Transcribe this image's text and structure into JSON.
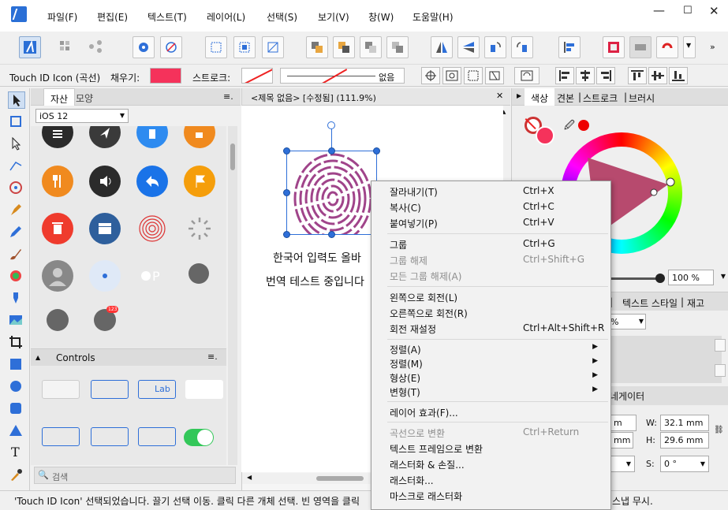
{
  "menubar": {
    "items": [
      "파일(F)",
      "편집(E)",
      "텍스트(T)",
      "레이어(L)",
      "선택(S)",
      "보기(V)",
      "창(W)",
      "도움말(H)"
    ]
  },
  "context": {
    "selection_name": "Touch ID Icon (곡선)",
    "fill_label": "채우기:",
    "stroke_label": "스트로크:",
    "stroke_value": "없음",
    "fill_color": "#f5325b"
  },
  "assets": {
    "tab_assets": "자산",
    "tab_shapes": "모양",
    "category": "iOS 12",
    "section": "Controls",
    "control_label": "Lab",
    "badge": "123",
    "search_placeholder": "검색",
    "left_arrow": "◀"
  },
  "document": {
    "tab_title": "<제목 없음> [수정됨] (111.9%)",
    "close": "✕",
    "text_line1": "한국어 입력도 올바",
    "text_line2": "번역 테스트 중입니다"
  },
  "right_panel": {
    "tab_color": "색상",
    "tab_swatches": "견본",
    "tab_stroke": "스트로크",
    "tab_brush": "브러시",
    "opacity": "100 %",
    "tab_text_style": "텍스트 스타일",
    "tab_stock": "재고",
    "percent_fragment": "%",
    "navigator_fragment": "네게이터",
    "w_label": "W:",
    "w_value": "32.1 mm",
    "h_label": "H:",
    "h_value": "29.6 mm",
    "s_label": "S:",
    "s_value": "0 °",
    "mm1": "m",
    "mm2": "mm",
    "seg_fragment": "일",
    "separator": "|"
  },
  "statusbar": {
    "text": "'Touch ID Icon' 선택되었습니다. 끌기 선택 이동. 클릭 다른 개체 선택. 빈 영역을 클릭",
    "text_right": "스냅 무시."
  },
  "context_menu": {
    "items": [
      {
        "label": "잘라내기(T)",
        "shortcut": "Ctrl+X"
      },
      {
        "label": "복사(C)",
        "shortcut": "Ctrl+C"
      },
      {
        "label": "붙여넣기(P)",
        "shortcut": "Ctrl+V"
      },
      {
        "label": "그룹",
        "shortcut": "Ctrl+G"
      },
      {
        "label": "그룹 해제",
        "shortcut": "Ctrl+Shift+G"
      },
      {
        "label": "모든 그룹 해제(A)",
        "shortcut": ""
      },
      {
        "label": "왼쪽으로 회전(L)",
        "shortcut": ""
      },
      {
        "label": "오른쪽으로 회전(R)",
        "shortcut": ""
      },
      {
        "label": "회전 재설정",
        "shortcut": "Ctrl+Alt+Shift+R"
      },
      {
        "label": "정렬(A)",
        "shortcut": ""
      },
      {
        "label": "정렬(M)",
        "shortcut": ""
      },
      {
        "label": "형상(E)",
        "shortcut": ""
      },
      {
        "label": "변형(T)",
        "shortcut": ""
      },
      {
        "label": "레이어 효과(F)...",
        "shortcut": ""
      },
      {
        "label": "곡선으로 변환",
        "shortcut": "Ctrl+Return"
      },
      {
        "label": "텍스트 프레임으로 변환",
        "shortcut": ""
      },
      {
        "label": "래스터화 & 손질...",
        "shortcut": ""
      },
      {
        "label": "래스터화...",
        "shortcut": ""
      },
      {
        "label": "마스크로 래스터화",
        "shortcut": ""
      }
    ],
    "submenu_arrow": "▶"
  },
  "colors": {
    "accent": "#2e6fd8",
    "fingerprint": "#a0448a",
    "selection": "#2e6fd8"
  }
}
